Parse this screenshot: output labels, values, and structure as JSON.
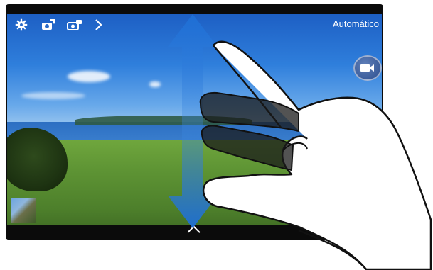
{
  "camera": {
    "mode_label": "Automático",
    "icons": {
      "settings": "gear-icon",
      "switch_camera": "switch-camera-icon",
      "shooting_mode": "camera-mode-icon",
      "expand": "chevron-right-icon",
      "record": "video-camera-icon",
      "panel_handle": "chevron-up-icon"
    }
  },
  "gesture": {
    "type": "two-finger vertical drag",
    "directions": [
      "up",
      "down"
    ],
    "arrow_color": "#1e6fd6"
  }
}
